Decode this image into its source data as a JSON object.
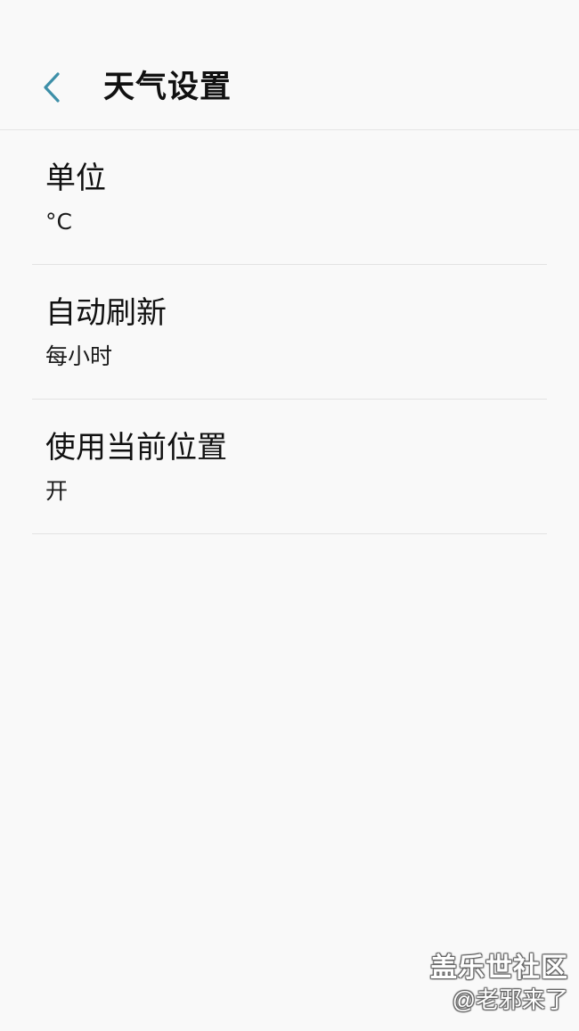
{
  "header": {
    "title": "天气设置",
    "back_icon": "chevron-left-icon",
    "accent_color": "#3d8fa8"
  },
  "settings": [
    {
      "title": "单位",
      "value": "°C"
    },
    {
      "title": "自动刷新",
      "value": "每小时"
    },
    {
      "title": "使用当前位置",
      "value": "开"
    }
  ],
  "watermark": {
    "brand": "盖乐世社区",
    "user": "@老邪来了"
  }
}
